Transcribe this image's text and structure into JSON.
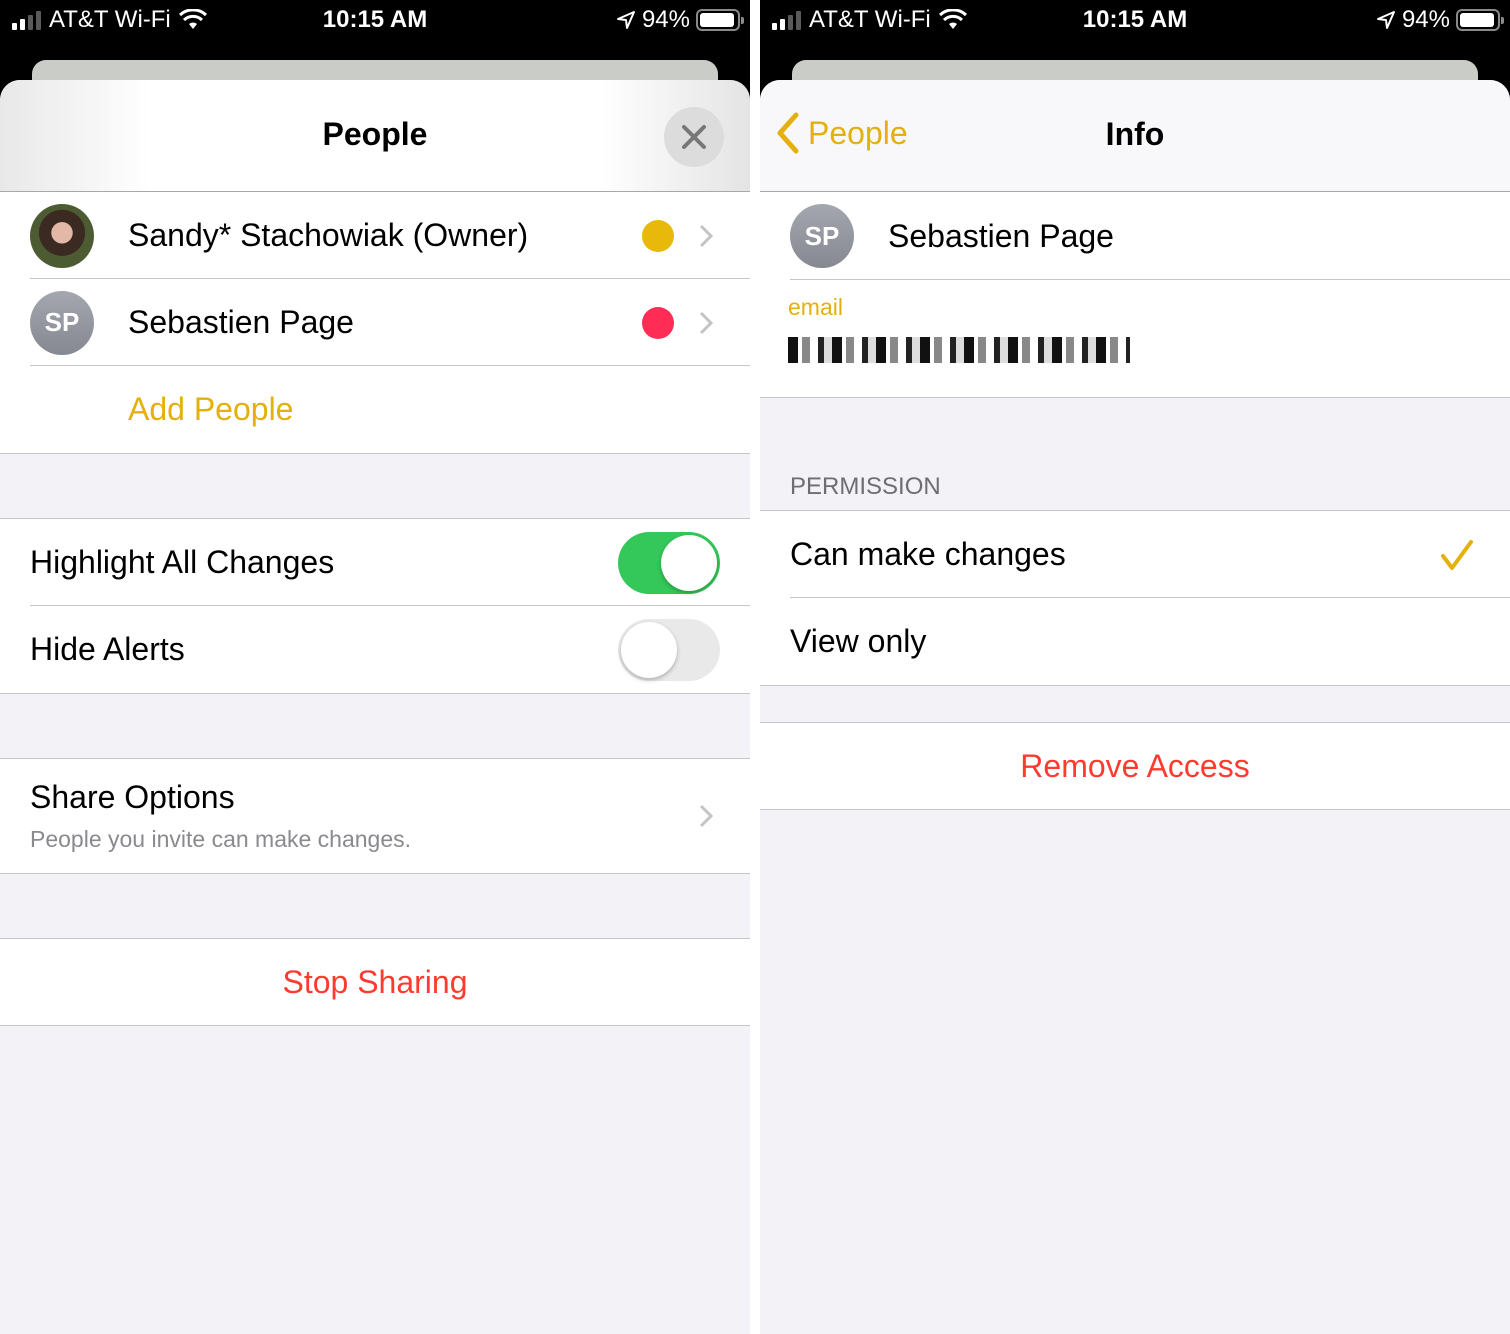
{
  "status_bar": {
    "carrier": "AT&T Wi-Fi",
    "time": "10:15 AM",
    "battery_percent_label": "94%",
    "battery_level": 0.94,
    "icons": [
      "signal-icon",
      "wifi-icon",
      "location-arrow-icon",
      "battery-icon"
    ]
  },
  "left_screen": {
    "nav": {
      "title": "People",
      "close_icon": "close-icon"
    },
    "people": [
      {
        "name": "Sandy* Stachowiak (Owner)",
        "avatar": "photo",
        "color": "#e8b90a"
      },
      {
        "name": "Sebastien Page",
        "avatar_initials": "SP",
        "color": "#ff2d55"
      }
    ],
    "add_people_label": "Add People",
    "settings": [
      {
        "label": "Highlight All Changes",
        "enabled": true
      },
      {
        "label": "Hide Alerts",
        "enabled": false
      }
    ],
    "share_options": {
      "title": "Share Options",
      "subtitle": "People you invite can make changes."
    },
    "stop_sharing_label": "Stop Sharing"
  },
  "right_screen": {
    "nav": {
      "back_label": "People",
      "title": "Info"
    },
    "person": {
      "name": "Sebastien Page",
      "avatar_initials": "SP"
    },
    "email": {
      "label": "email",
      "value": "[redacted]"
    },
    "permission": {
      "header": "PERMISSION",
      "options": [
        {
          "label": "Can make changes",
          "selected": true
        },
        {
          "label": "View only",
          "selected": false
        }
      ]
    },
    "remove_access_label": "Remove Access"
  },
  "colors": {
    "accent": "#e4b00c",
    "destructive": "#ff3b30",
    "toggle_on": "#34c759",
    "grouped_background": "#f2f2f7"
  }
}
